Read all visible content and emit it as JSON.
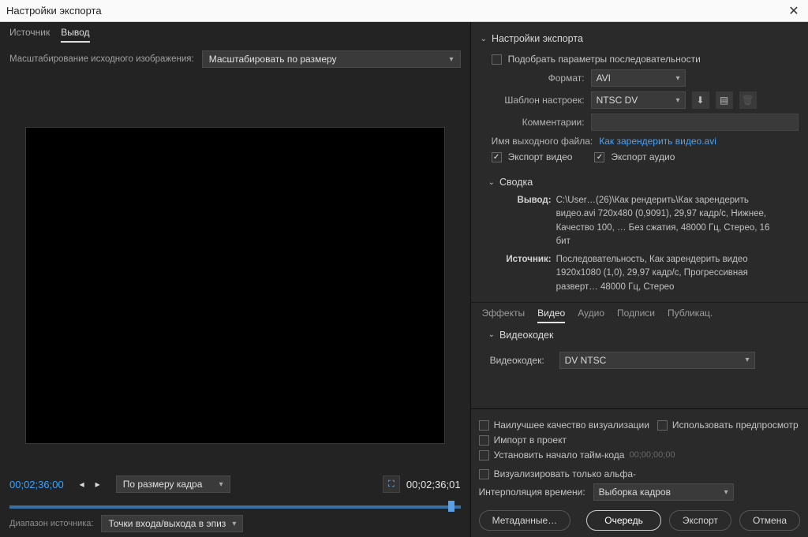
{
  "title": "Настройки экспорта",
  "left": {
    "tabs": {
      "source": "Источник",
      "output": "Вывод"
    },
    "scale_label": "Масштабирование исходного изображения:",
    "scale_value": "Масштабировать по размеру",
    "time_in": "00;02;36;00",
    "time_out": "00;02;36;01",
    "fit_label": "По размеру кадра",
    "range_label": "Диапазон источника:",
    "range_value": "Точки входа/выхода в эпиз"
  },
  "export": {
    "header": "Настройки экспорта",
    "match_sequence": {
      "label": "Подобрать параметры последовательности",
      "checked": false
    },
    "format": {
      "label": "Формат:",
      "value": "AVI"
    },
    "preset": {
      "label": "Шаблон настроек:",
      "value": "NTSC DV"
    },
    "comments": {
      "label": "Комментарии:"
    },
    "output_name": {
      "label": "Имя выходного файла:",
      "value": "Как зарендерить видео.avi"
    },
    "export_video": {
      "label": "Экспорт видео",
      "checked": true
    },
    "export_audio": {
      "label": "Экспорт аудио",
      "checked": true
    },
    "summary_header": "Сводка",
    "summary": {
      "output_label": "Вывод:",
      "output_value": "C:\\User…(26)\\Как рендерить\\Как зарендерить видео.avi 720x480 (0,9091), 29,97 кадр/с, Нижнее, Качество 100, … Без сжатия, 48000 Гц, Стерео, 16 бит",
      "source_label": "Источник:",
      "source_value": "Последовательность, Как зарендерить видео 1920x1080 (1,0), 29,97 кадр/с, Прогрессивная разверт… 48000 Гц, Стерео"
    }
  },
  "tabs": {
    "effects": "Эффекты",
    "video": "Видео",
    "audio": "Аудио",
    "captions": "Подписи",
    "publish": "Публикац."
  },
  "video": {
    "codec_header": "Видеокодек",
    "codec_label": "Видеокодек:",
    "codec_value": "DV NTSC"
  },
  "bottom": {
    "max_quality": {
      "label": "Наилучшее качество визуализации",
      "checked": false
    },
    "use_preview": {
      "label": "Использовать предпросмотр",
      "checked": false
    },
    "import_project": {
      "label": "Импорт в проект",
      "checked": false
    },
    "set_tc": {
      "label": "Установить начало тайм-кода",
      "value": "00;00;00;00",
      "checked": false
    },
    "alpha_only": {
      "label": "Визуализировать только альфа-",
      "checked": false
    },
    "interp_label": "Интерполяция времени:",
    "interp_value": "Выборка кадров"
  },
  "footer": {
    "metadata": "Метаданные…",
    "queue": "Очередь",
    "export": "Экспорт",
    "cancel": "Отмена"
  }
}
